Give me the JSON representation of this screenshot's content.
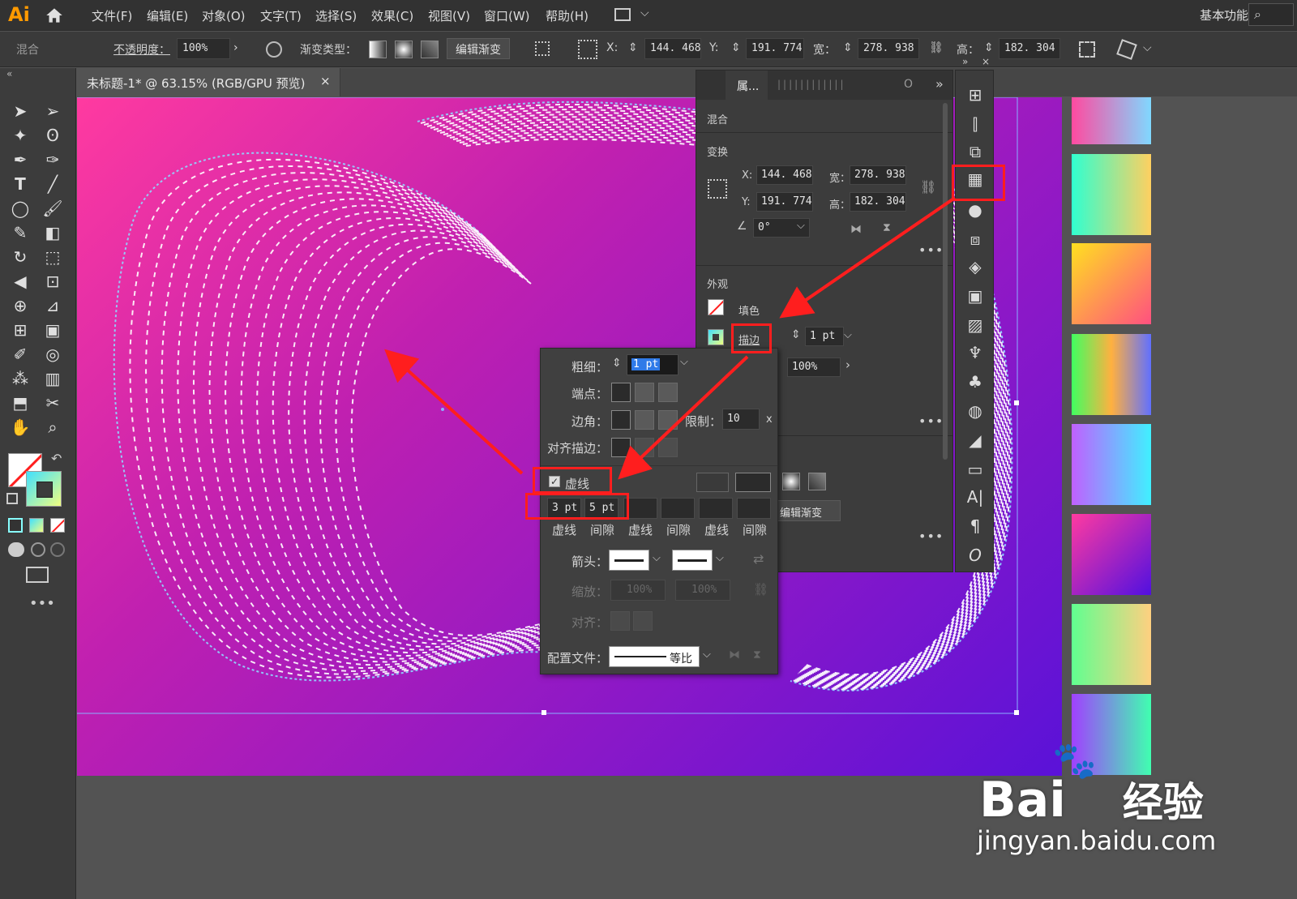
{
  "app": {
    "logo": "Ai",
    "workspace": "基本功能"
  },
  "menu": [
    "文件(F)",
    "编辑(E)",
    "对象(O)",
    "文字(T)",
    "选择(S)",
    "效果(C)",
    "视图(V)",
    "窗口(W)",
    "帮助(H)"
  ],
  "control": {
    "mode": "混合",
    "opacity_label": "不透明度：",
    "opacity_value": "100%",
    "gradient_type_label": "渐变类型：",
    "edit_gradient": "编辑渐变",
    "x_label": "X:",
    "x_value": "144. 468",
    "y_label": "Y:",
    "y_value": "191. 774",
    "w_label": "宽：",
    "w_value": "278. 938",
    "h_label": "高：",
    "h_value": "182. 304"
  },
  "document_tab": {
    "title": "未标题-1* @ 63.15% (RGB/GPU 预览)",
    "close": "×"
  },
  "properties": {
    "tab": "属...",
    "section_mix": "混合",
    "section_transform": "变换",
    "x_label": "X:",
    "x_value": "144. 468",
    "y_label": "Y:",
    "y_value": "191. 774",
    "w_label": "宽：",
    "w_value": "278. 938",
    "h_label": "高：",
    "h_value": "182. 304",
    "angle_value": "0°",
    "section_appearance": "外观",
    "fill_label": "填色",
    "stroke_label": "描边",
    "stroke_weight": "1 pt",
    "opacity_value": "100%",
    "edit_gradient": "编辑渐变"
  },
  "stroke_panel": {
    "weight_label": "粗细：",
    "weight_value": "1 pt",
    "cap_label": "端点：",
    "corner_label": "边角：",
    "limit_label": "限制：",
    "limit_value": "10",
    "limit_unit": "x",
    "align_label": "对齐描边：",
    "dashed_label": "虚线",
    "dashed_checked": true,
    "dash1": "3 pt",
    "gap1": "5 pt",
    "dash_labels": [
      "虚线",
      "间隙",
      "虚线",
      "间隙",
      "虚线",
      "间隙"
    ],
    "arrow_label": "箭头：",
    "scale_label": "缩放：",
    "scale_value1": "100%",
    "scale_value2": "100%",
    "align_arrow_label": "对齐：",
    "profile_label": "配置文件：",
    "profile_value": "等比"
  },
  "colors": {
    "annotation": "#ff1e1e",
    "dash_stroke": "#ffffff",
    "dash_accent": "#8fd8ff"
  },
  "watermark": {
    "brand": "Bai",
    "brand2": "经验",
    "url": "jingyan.baidu.com"
  }
}
